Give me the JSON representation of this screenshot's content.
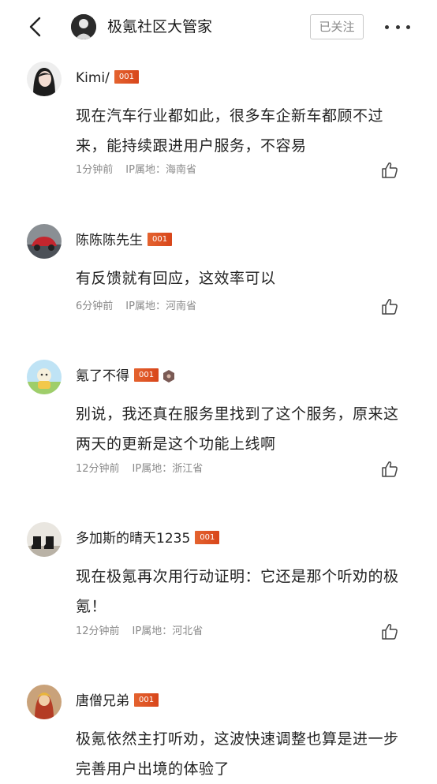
{
  "header": {
    "title": "极氪社区大管家",
    "follow_label": "已关注"
  },
  "comments": [
    {
      "username": "Kimi/",
      "badge": "001",
      "text": "现在汽车行业都如此，很多车企新车都顾不过来，能持续跟进用户服务，不容易",
      "time": "1分钟前",
      "ip": "IP属地：海南省"
    },
    {
      "username": "陈陈陈先生",
      "badge": "001",
      "text": "有反馈就有回应，这效率可以",
      "time": "6分钟前",
      "ip": "IP属地：河南省"
    },
    {
      "username": "氪了不得",
      "badge": "001",
      "text": "别说，我还真在服务里找到了这个服务，原来这两天的更新是这个功能上线啊",
      "time": "12分钟前",
      "ip": "IP属地：浙江省"
    },
    {
      "username": "多加斯的晴天1235",
      "badge": "001",
      "text": "现在极氪再次用行动证明：它还是那个听劝的极氪！",
      "time": "12分钟前",
      "ip": "IP属地：河北省"
    },
    {
      "username": "唐僧兄弟",
      "badge": "001",
      "text": "极氪依然主打听劝，这波快速调整也算是进一步完善用户出境的体验了",
      "time": "",
      "ip": ""
    }
  ],
  "colors": {
    "badge": "#e0572a",
    "meta": "#8a8a8a",
    "text": "#222222"
  }
}
